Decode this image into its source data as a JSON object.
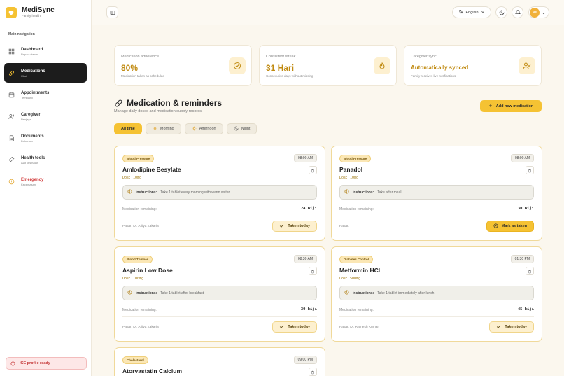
{
  "brand": {
    "name": "MediSync",
    "subtitle": "Family health"
  },
  "sidebar": {
    "heading": "Main navigation",
    "items": [
      {
        "label": "Dashboard",
        "sub": "Papan utama",
        "icon": "grid-icon",
        "active": false
      },
      {
        "label": "Medications",
        "sub": "Ubat",
        "icon": "pill-icon",
        "active": true
      },
      {
        "label": "Appointments",
        "sub": "Temujanji",
        "icon": "calendar-icon",
        "active": false
      },
      {
        "label": "Caregiver",
        "sub": "Penjaga",
        "icon": "users-icon",
        "active": false
      },
      {
        "label": "Documents",
        "sub": "Dokumen",
        "icon": "document-icon",
        "active": false
      },
      {
        "label": "Health tools",
        "sub": "Alat kesihatan",
        "icon": "tools-icon",
        "active": false
      },
      {
        "label": "Emergency",
        "sub": "Kecemasan",
        "icon": "alert-icon",
        "active": false,
        "danger": true
      }
    ],
    "ice": "ICE profile ready"
  },
  "topbar": {
    "language": "English",
    "avatar": "NF"
  },
  "stats": [
    {
      "title": "Medication adherence",
      "value": "80%",
      "sub": "Medication taken as scheduled"
    },
    {
      "title": "Consistent streak",
      "value": "31 Hari",
      "sub": "Consecutive days without missing"
    },
    {
      "title": "Caregiver sync",
      "value": "Automatically synced",
      "sub": "Family receives live notifications"
    }
  ],
  "section": {
    "title": "Medication & reminders",
    "subtitle": "Manage daily doses and medication supply records.",
    "add_label": "Add new medication"
  },
  "filters": [
    "All time",
    "Morning",
    "Afternoon",
    "Night"
  ],
  "labels": {
    "instructions": "Instructions:",
    "remaining": "Medication remaining:"
  },
  "cards": [
    {
      "tag": "Blood Pressure",
      "time": "08:00 AM",
      "name": "Amlodipine Besylate",
      "dose": "Dos: 10mg",
      "instruction": "Take 1 tablet every morning with warm water",
      "remaining": "24 biji",
      "doctor": "Pakar: Dr. Ariiya Zakaria",
      "action": "Taken today",
      "state": "taken"
    },
    {
      "tag": "Blood Pressure",
      "time": "08:00 AM",
      "name": "Panadol",
      "dose": "Dos: 10mg",
      "instruction": "Take after meal",
      "remaining": "30 biji",
      "doctor": "Pakar:",
      "action": "Mark as taken",
      "state": "mark"
    },
    {
      "tag": "Blood Thinner",
      "time": "08:30 AM",
      "name": "Aspirin Low Dose",
      "dose": "Dos: 100mg",
      "instruction": "Take 1 tablet after breakfast",
      "remaining": "30 biji",
      "doctor": "Pakar: Dr. Ariiya Zakaria",
      "action": "Taken today",
      "state": "taken"
    },
    {
      "tag": "Diabetes Control",
      "time": "01:30 PM",
      "name": "Metformin HCl",
      "dose": "Dos: 500mg",
      "instruction": "Take 1 tablet immediately after lunch",
      "remaining": "45 biji",
      "doctor": "Pakar: Dr. Ramesh Kumar",
      "action": "Taken today",
      "state": "taken"
    },
    {
      "tag": "Cholesterol",
      "time": "09:00 PM",
      "name": "Atorvastatin Calcium"
    }
  ],
  "colors": {
    "accent": "#f5c233",
    "dark": "#1c1c1c",
    "danger": "#d23b3b"
  }
}
